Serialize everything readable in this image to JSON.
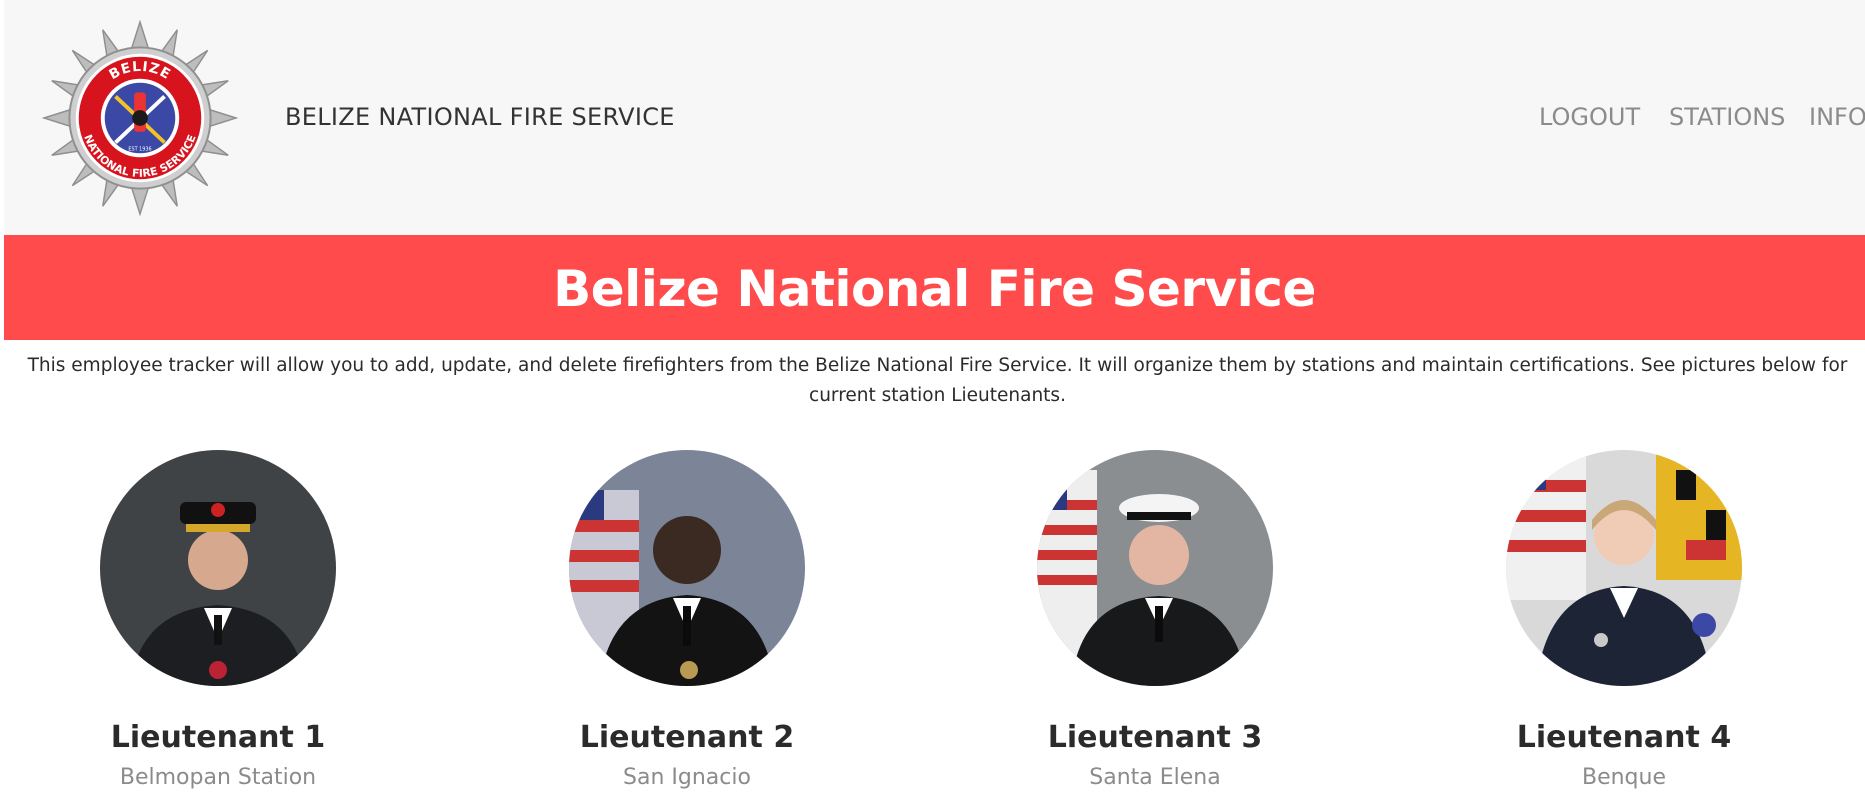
{
  "navbar": {
    "brand": "BELIZE NATIONAL FIRE SERVICE",
    "logo_text_top": "BELIZE",
    "logo_text_ring": "NATIONAL FIRE SERVICE",
    "logo_est": "EST 1936",
    "links": [
      {
        "label": "LOGOUT"
      },
      {
        "label": "STATIONS"
      },
      {
        "label": "INFO"
      }
    ]
  },
  "banner": {
    "title": "Belize National Fire Service"
  },
  "intro": {
    "text": "This employee tracker will allow you to add, update, and delete firefighters from the Belize National Fire Service. It will organize them by stations and maintain certifications. See pictures below for current station Lieutenants."
  },
  "lieutenants": [
    {
      "name": "Lieutenant 1",
      "station": "Belmopan Station"
    },
    {
      "name": "Lieutenant 2",
      "station": "San Ignacio"
    },
    {
      "name": "Lieutenant 3",
      "station": "Santa Elena"
    },
    {
      "name": "Lieutenant 4",
      "station": "Benque"
    }
  ],
  "colors": {
    "banner": "#ff4b4b",
    "navbar_bg": "#f7f7f7",
    "nav_link": "#8b8b8b",
    "text": "#2b2b2b"
  }
}
